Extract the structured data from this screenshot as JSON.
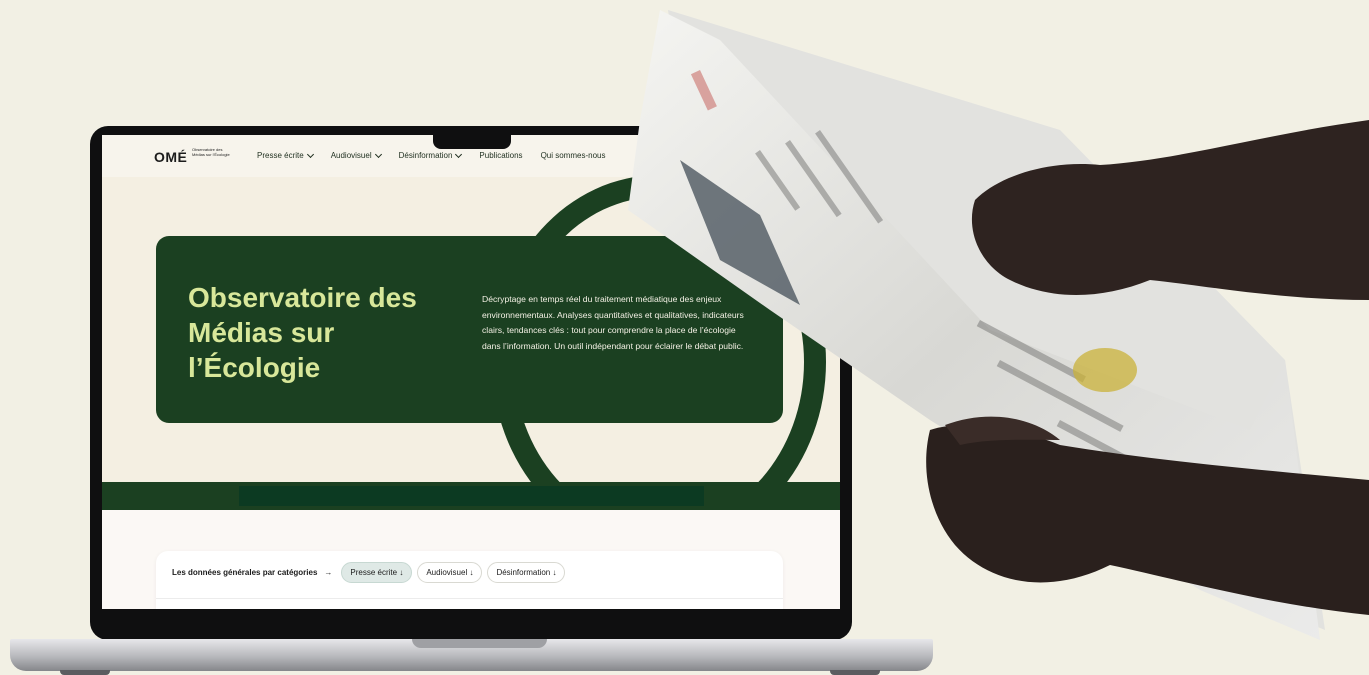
{
  "brand": {
    "logo": "OMÉ",
    "logo_subtitle": "Observatoire des Médias sur l'Écologie"
  },
  "nav": {
    "items": [
      {
        "label": "Presse écrite",
        "dropdown": true
      },
      {
        "label": "Audiovisuel",
        "dropdown": true
      },
      {
        "label": "Désinformation",
        "dropdown": true
      },
      {
        "label": "Publications",
        "dropdown": false
      },
      {
        "label": "Qui sommes-nous",
        "dropdown": false
      }
    ]
  },
  "hero": {
    "title": "Observatoire des Médias sur l’Écologie",
    "description": "Décryptage en temps réel du traitement médiatique des enjeux environnementaux. Analyses quantitatives et qualitatives, indicateurs clairs, tendances clés : tout pour comprendre la place de l’écologie dans l’information. Un outil indépendant pour éclairer le débat public."
  },
  "filters": {
    "label": "Les données générales par catégories",
    "arrow": "→",
    "pills": [
      {
        "label": "Presse écrite ↓",
        "active": true
      },
      {
        "label": "Audiovisuel ↓",
        "active": false
      },
      {
        "label": "Désinformation ↓",
        "active": false
      }
    ]
  },
  "colors": {
    "background": "#f2f0e4",
    "brand_green": "#1b4021",
    "title_green": "#d8e79a",
    "active_pill": "#dfe9e6"
  },
  "icons": {
    "nav_dropdown": "chevron-down-icon",
    "filter_arrow": "arrow-right-icon"
  }
}
